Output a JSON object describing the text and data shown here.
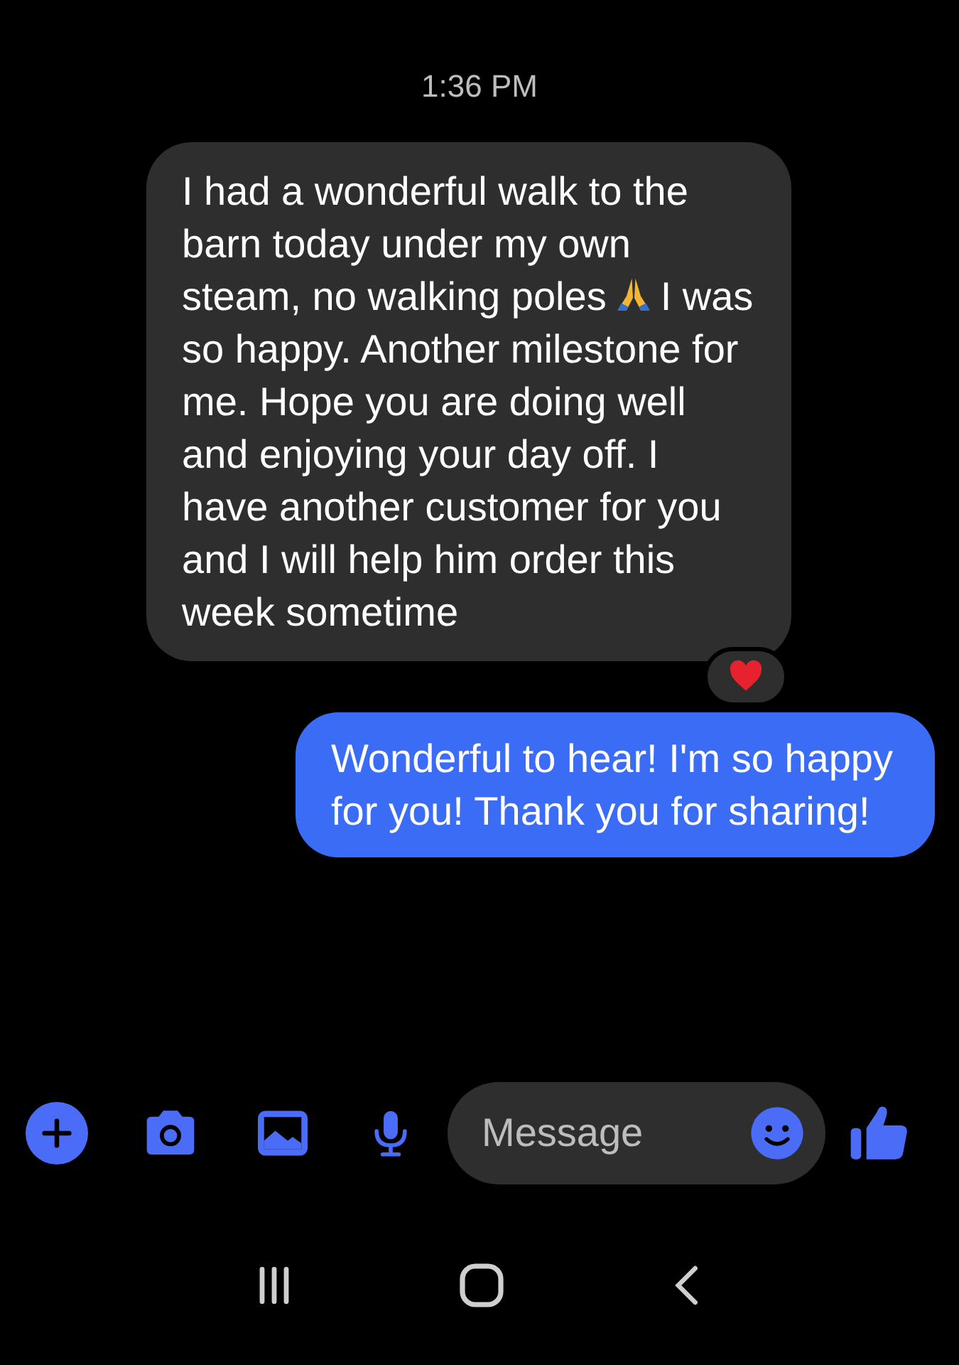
{
  "timestamp": "1:36 PM",
  "messages": [
    {
      "kind": "received",
      "text_parts": [
        "I had a wonderful walk to the barn today under my own steam, no walking poles",
        "I was so happy. Another milestone for me. Hope you are doing well and enjoying your day off. I have another customer for you and I will help him order this week sometime"
      ],
      "reacted": true
    },
    {
      "kind": "sent",
      "text_parts": [
        "Wonderful to hear! I'm so happy for you! Thank you for sharing!"
      ],
      "reacted": false
    }
  ],
  "composer": {
    "placeholder": "Message"
  }
}
